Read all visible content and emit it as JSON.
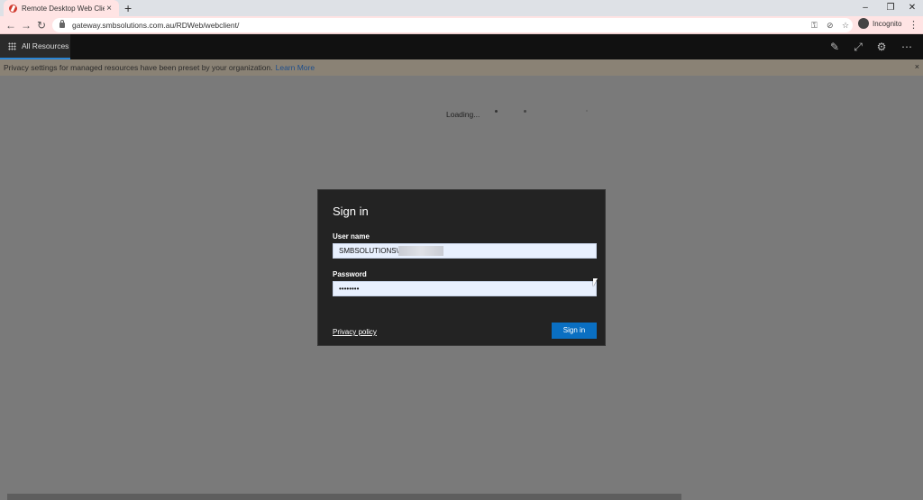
{
  "browser": {
    "tab_title": "Remote Desktop Web Client",
    "tab_close": "×",
    "new_tab": "+",
    "url": "gateway.smbsolutions.com.au/RDWeb/webclient/",
    "incognito_label": "Incognito",
    "window_controls": {
      "minimize": "–",
      "restore": "❐",
      "close": "✕"
    },
    "nav": {
      "back": "←",
      "forward": "→",
      "reload": "↻"
    },
    "menu": "⋮"
  },
  "rd": {
    "tab_label": "All Resources",
    "icons": [
      "pin-icon",
      "fullscreen-icon",
      "settings-icon",
      "more-icon"
    ]
  },
  "banner": {
    "text": "Privacy settings for managed resources have been preset by your organization.",
    "link": "Learn More",
    "close": "×"
  },
  "loading": {
    "text": "Loading..."
  },
  "dialog": {
    "title": "Sign in",
    "username_label": "User name",
    "username_value": "SMBSOLUTIONS\\",
    "password_label": "Password",
    "password_value": "••••••••",
    "privacy_link": "Privacy policy",
    "signin_button": "Sign in"
  },
  "colors": {
    "accent": "#0a6fc2",
    "dialog_bg": "#232323",
    "overlay_bg": "#7a7a7a",
    "banner_bg": "#8a8275",
    "incognito_tint": "#ffe4e4"
  }
}
